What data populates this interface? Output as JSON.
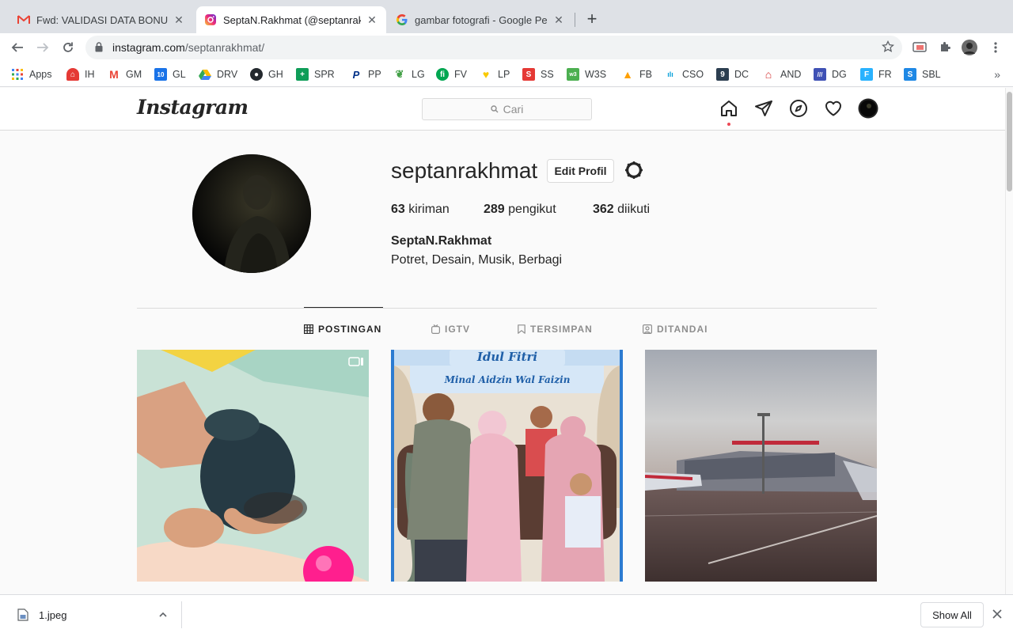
{
  "browser": {
    "tabs": [
      {
        "title": "Fwd: VALIDASI DATA BONUS S",
        "favicon": "gmail-icon",
        "active": false
      },
      {
        "title": "SeptaN.Rakhmat (@septanrakl",
        "favicon": "instagram-icon",
        "active": true
      },
      {
        "title": "gambar fotografi - Google Pen",
        "favicon": "google-icon",
        "active": false
      }
    ],
    "new_tab_label": "+",
    "url_host": "instagram.com",
    "url_path": "/septanrakhmat/",
    "bookmarks": [
      {
        "label": "Apps",
        "icon": "apps-grid-icon",
        "color": "#4285f4"
      },
      {
        "label": "IH",
        "icon": "ih-icon",
        "color": "#e53935"
      },
      {
        "label": "GM",
        "icon": "gmail-icon",
        "color": "#ea4335"
      },
      {
        "label": "GL",
        "icon": "calendar-icon",
        "color": "#1a73e8"
      },
      {
        "label": "DRV",
        "icon": "drive-icon",
        "color": "#fbbc04"
      },
      {
        "label": "GH",
        "icon": "github-icon",
        "color": "#24292e"
      },
      {
        "label": "SPR",
        "icon": "spreadsheet-icon",
        "color": "#0f9d58"
      },
      {
        "label": "PP",
        "icon": "paypal-icon",
        "color": "#003087"
      },
      {
        "label": "LG",
        "icon": "leaf-icon",
        "color": "#43a047"
      },
      {
        "label": "FV",
        "icon": "fv-icon",
        "color": "#00a651"
      },
      {
        "label": "LP",
        "icon": "heart-icon",
        "color": "#f9c900"
      },
      {
        "label": "SS",
        "icon": "ss-icon",
        "color": "#e53935"
      },
      {
        "label": "W3S",
        "icon": "w3s-icon",
        "color": "#4caf50"
      },
      {
        "label": "FB",
        "icon": "firebase-icon",
        "color": "#ffa000"
      },
      {
        "label": "CSO",
        "icon": "cisco-icon",
        "color": "#049fd9"
      },
      {
        "label": "DC",
        "icon": "dc-icon",
        "color": "#2c3e50"
      },
      {
        "label": "AND",
        "icon": "home-icon",
        "color": "#d32f2f"
      },
      {
        "label": "DG",
        "icon": "dg-icon",
        "color": "#3f51b5"
      },
      {
        "label": "FR",
        "icon": "freelancer-icon",
        "color": "#29b2fe"
      },
      {
        "label": "SBL",
        "icon": "sbl-icon",
        "color": "#1e88e5"
      }
    ],
    "bookmarks_more": "»"
  },
  "instagram": {
    "logo": "Instagram",
    "search_placeholder": "Cari",
    "profile": {
      "username": "septanrakhmat",
      "edit_button": "Edit Profil",
      "posts_count": "63",
      "posts_label": "kiriman",
      "followers_count": "289",
      "followers_label": "pengikut",
      "following_count": "362",
      "following_label": "diikuti",
      "full_name": "SeptaN.Rakhmat",
      "bio": "Potret, Desain, Musik, Berbagi"
    },
    "tabs": [
      {
        "label": "POSTINGAN",
        "icon": "grid-icon",
        "active": true
      },
      {
        "label": "IGTV",
        "icon": "igtv-icon",
        "active": false
      },
      {
        "label": "TERSIMPAN",
        "icon": "bookmark-icon",
        "active": false
      },
      {
        "label": "DITANDAI",
        "icon": "tagged-icon",
        "active": false
      }
    ],
    "posts": [
      {
        "subject": "child crawling",
        "badge": "video-icon"
      },
      {
        "subject": "family photo",
        "banner_top": "Idul Fitri",
        "banner_sub": "Minal Aidzin Wal Faizin"
      },
      {
        "subject": "airport terminal at dusk"
      }
    ]
  },
  "downloads": {
    "file_name": "1.jpeg",
    "show_all": "Show All"
  }
}
